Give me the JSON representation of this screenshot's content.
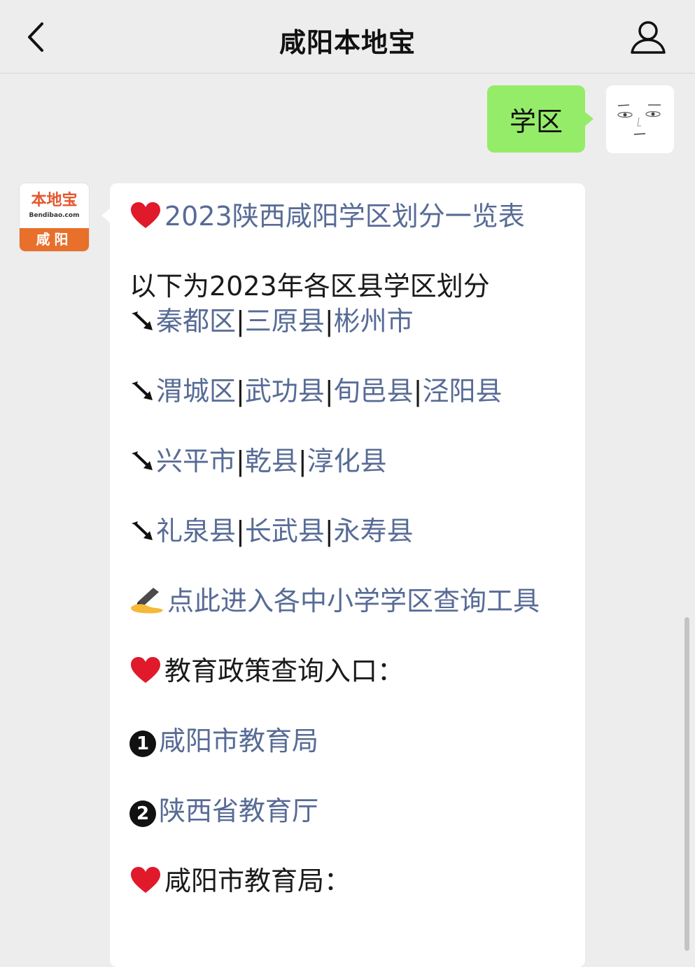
{
  "header": {
    "title": "咸阳本地宝"
  },
  "user_message": {
    "text": "学区"
  },
  "bot_avatar": {
    "logo_main": "本地宝",
    "logo_sub": "Bendibao.com",
    "city": "咸阳"
  },
  "reply": {
    "heading_link": "2023陕西咸阳学区划分一览表",
    "intro": "以下为2023年各区县学区划分",
    "district_rows": [
      [
        "秦都区",
        "三原县",
        "彬州市"
      ],
      [
        "渭城区",
        "武功县",
        "旬邑县",
        "泾阳县"
      ],
      [
        "兴平市",
        "乾县",
        "淳化县"
      ],
      [
        "礼泉县",
        "长武县",
        "永寿县"
      ]
    ],
    "separator": "|",
    "query_tool_link": "点此进入各中小学学区查询工具",
    "policy_heading": "教育政策查询入口：",
    "policy_links": [
      {
        "badge": "1",
        "label": "咸阳市教育局"
      },
      {
        "badge": "2",
        "label": "陕西省教育厅"
      }
    ],
    "bottom_heading": "咸阳市教育局："
  },
  "icons": {
    "back": "chevron-left-icon",
    "profile": "person-icon",
    "heart": "heart-icon",
    "arrow": "diagonal-arrow-icon",
    "writing": "writing-hand-icon"
  },
  "colors": {
    "link": "#576b95",
    "user_bubble": "#95ec69",
    "background": "#ededed",
    "accent": "#e8702a"
  }
}
